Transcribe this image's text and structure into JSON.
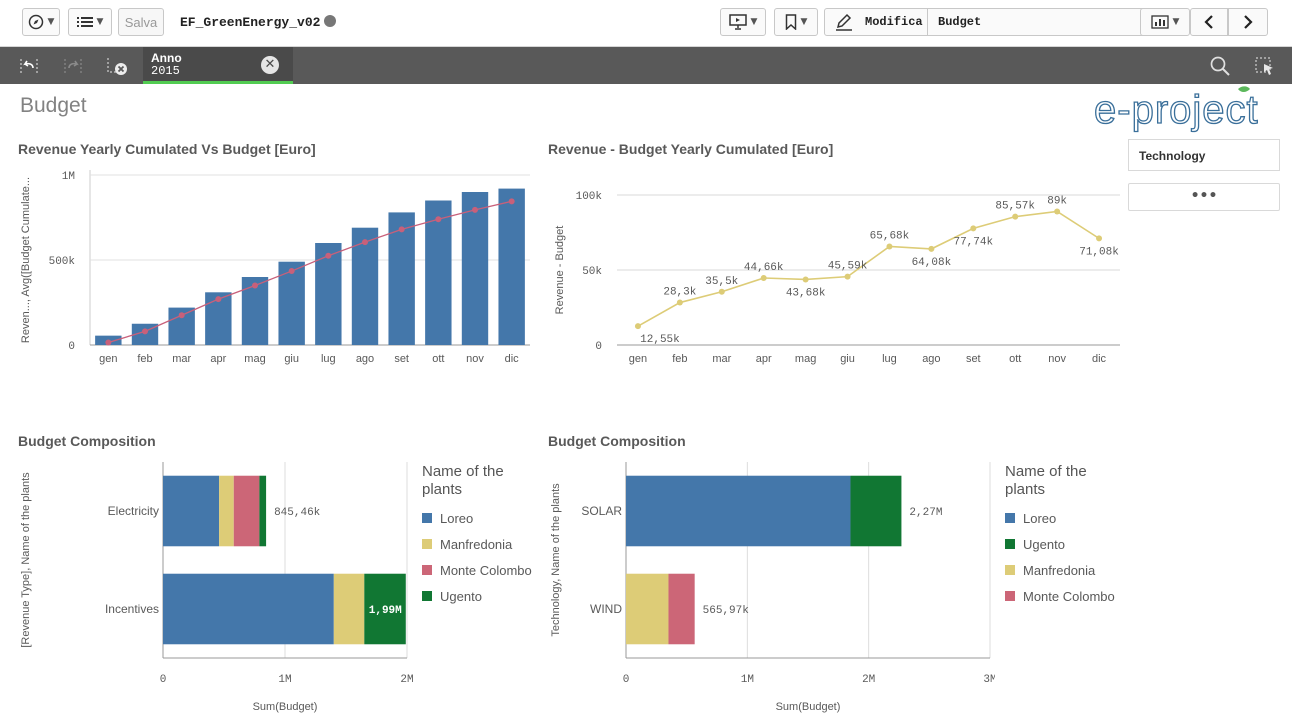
{
  "toolbar": {
    "save_label": "Salva",
    "app_title": "EF_GreenEnergy_v02",
    "edit_label": "Modifica",
    "sheet_label": "Budget",
    "icons": [
      "compass-icon",
      "list-icon",
      "present-icon",
      "bookmark-icon",
      "pencil-icon",
      "chart-icon",
      "prev-icon",
      "next-icon"
    ]
  },
  "selections": {
    "field": "Anno",
    "value": "2015"
  },
  "sheet": {
    "title": "Budget",
    "logo_text": "e-project"
  },
  "filters": {
    "technology_label": "Technology",
    "more_label": "•••"
  },
  "colors": {
    "bar_blue": "#4477aa",
    "avg_line": "#c8607a",
    "line_yellow": "#ddcc77",
    "loreo": "#4477aa",
    "manfredonia": "#ddcc77",
    "monte_colombo": "#cc6677",
    "ugento": "#117733"
  },
  "chart_data": [
    {
      "id": "cumulated",
      "type": "bar",
      "title": "Revenue Yearly Cumulated Vs Budget [Euro]",
      "ylabel": "Reven..., Avg([Budget Cumulate...",
      "categories": [
        "gen",
        "feb",
        "mar",
        "apr",
        "mag",
        "giu",
        "lug",
        "ago",
        "set",
        "ott",
        "nov",
        "dic"
      ],
      "ylim": [
        0,
        1000000
      ],
      "yticks": [
        {
          "v": 0,
          "t": "0"
        },
        {
          "v": 500000,
          "t": "500k"
        },
        {
          "v": 1000000,
          "t": "1M"
        }
      ],
      "series": [
        {
          "kind": "bar",
          "values": [
            55000,
            125000,
            220000,
            310000,
            400000,
            490000,
            600000,
            690000,
            780000,
            850000,
            900000,
            920000
          ]
        },
        {
          "kind": "line",
          "values": [
            15000,
            80000,
            175000,
            270000,
            350000,
            435000,
            525000,
            605000,
            680000,
            740000,
            795000,
            845000
          ]
        }
      ],
      "grid": true
    },
    {
      "id": "difference",
      "type": "line",
      "title": "Revenue - Budget Yearly Cumulated [Euro]",
      "ylabel": "Revenue - Budget",
      "categories": [
        "gen",
        "feb",
        "mar",
        "apr",
        "mag",
        "giu",
        "lug",
        "ago",
        "set",
        "ott",
        "nov",
        "dic"
      ],
      "ylim": [
        0,
        100000
      ],
      "yticks": [
        {
          "v": 0,
          "t": "0"
        },
        {
          "v": 50000,
          "t": "50k"
        },
        {
          "v": 100000,
          "t": "100k"
        }
      ],
      "series": [
        {
          "values": [
            12550,
            28300,
            35500,
            44660,
            43680,
            45590,
            65680,
            64080,
            77740,
            85570,
            89000,
            71080
          ],
          "labels": [
            "12,55k",
            "28,3k",
            "35,5k",
            "44,66k",
            "43,68k",
            "45,59k",
            "65,68k",
            "64,08k",
            "77,74k",
            "85,57k",
            "89k",
            "71,08k"
          ]
        }
      ],
      "grid": true
    },
    {
      "id": "composition_revenue_type",
      "type": "bar",
      "orientation": "horizontal",
      "stacked": true,
      "title": "Budget Composition",
      "ylabel": "[Revenue Type], Name of the plants",
      "xlabel": "Sum(Budget)",
      "categories": [
        "Electricity",
        "Incentives"
      ],
      "totals": [
        "845,46k",
        "1,99M"
      ],
      "xlim": [
        0,
        2000000
      ],
      "xticks": [
        {
          "v": 0,
          "t": "0"
        },
        {
          "v": 1000000,
          "t": "1M"
        },
        {
          "v": 2000000,
          "t": "2M"
        }
      ],
      "legend_title": "Name of the plants",
      "series": [
        {
          "name": "Loreo",
          "color": "#4477aa",
          "values": [
            460000,
            1400000
          ]
        },
        {
          "name": "Manfredonia",
          "color": "#ddcc77",
          "values": [
            120000,
            250000
          ]
        },
        {
          "name": "Monte Colombo",
          "color": "#cc6677",
          "values": [
            210000,
            0
          ]
        },
        {
          "name": "Ugento",
          "color": "#117733",
          "values": [
            55000,
            340000
          ]
        }
      ]
    },
    {
      "id": "composition_technology",
      "type": "bar",
      "orientation": "horizontal",
      "stacked": true,
      "title": "Budget Composition",
      "ylabel": "Technology, Name of the plants",
      "xlabel": "Sum(Budget)",
      "categories": [
        "SOLAR",
        "WIND"
      ],
      "totals": [
        "2,27M",
        "565,97k"
      ],
      "xlim": [
        0,
        3000000
      ],
      "xticks": [
        {
          "v": 0,
          "t": "0"
        },
        {
          "v": 1000000,
          "t": "1M"
        },
        {
          "v": 2000000,
          "t": "2M"
        },
        {
          "v": 3000000,
          "t": "3M"
        }
      ],
      "legend_title": "Name of the plants",
      "series": [
        {
          "name": "Loreo",
          "color": "#4477aa",
          "values": [
            1850000,
            0
          ]
        },
        {
          "name": "Ugento",
          "color": "#117733",
          "values": [
            420000,
            0
          ]
        },
        {
          "name": "Manfredonia",
          "color": "#ddcc77",
          "values": [
            0,
            350000
          ]
        },
        {
          "name": "Monte Colombo",
          "color": "#cc6677",
          "values": [
            0,
            215970
          ]
        }
      ]
    }
  ]
}
